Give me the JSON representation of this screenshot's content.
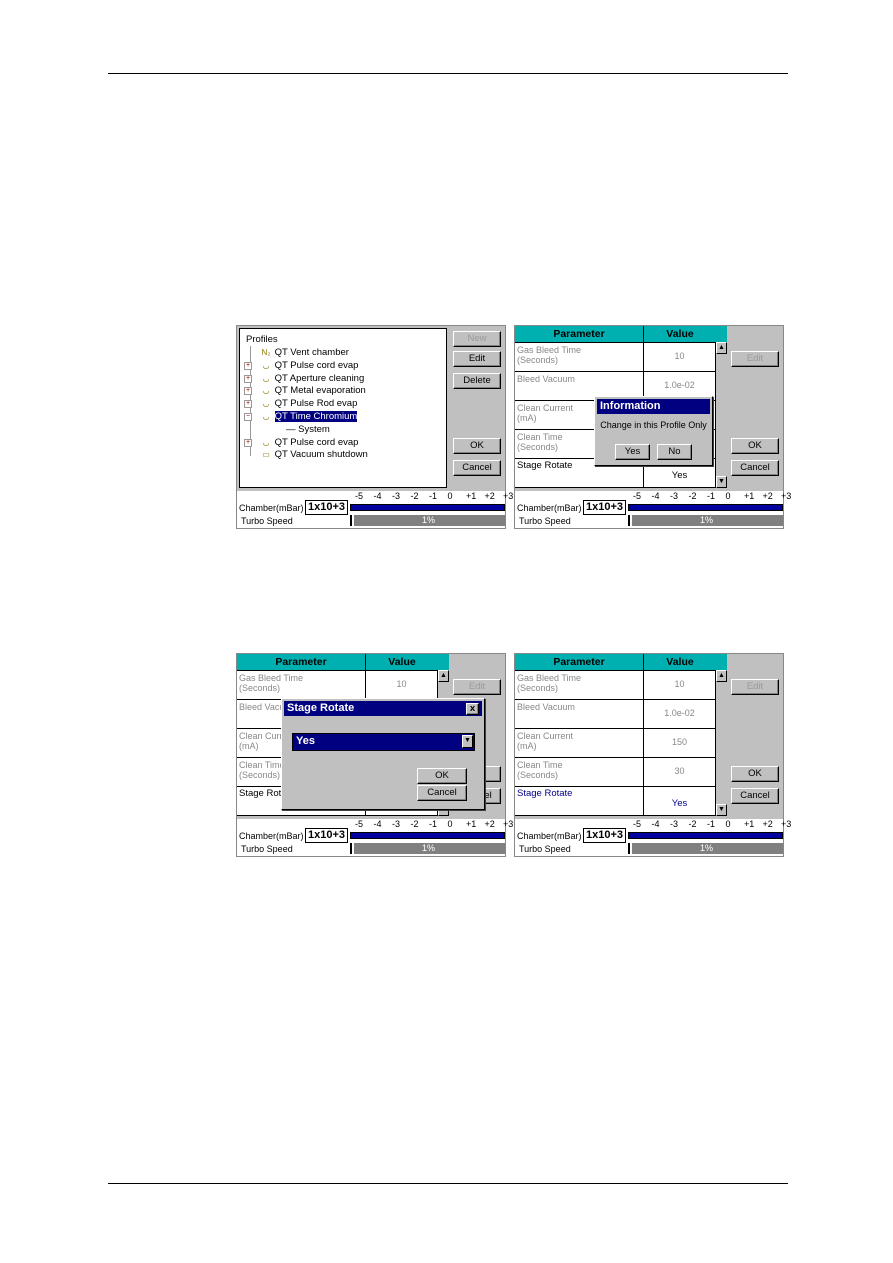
{
  "common": {
    "chamber_label": "Chamber(mBar)",
    "chamber_value": "1x10+3",
    "scale_ticks": [
      "-5",
      "-4",
      "-3",
      "-2",
      "-1",
      "0",
      "+1",
      "+2",
      "+3"
    ],
    "turbo_label": "Turbo Speed",
    "turbo_value": "1%",
    "turbo_fraction": 0.01,
    "param_header": "Parameter",
    "value_header": "Value",
    "edit": "Edit",
    "ok": "OK",
    "cancel": "Cancel"
  },
  "profiles_panel": {
    "root": "Profiles",
    "buttons": {
      "new": "New",
      "edit": "Edit",
      "delete": "Delete",
      "ok": "OK",
      "cancel": "Cancel"
    },
    "items": [
      {
        "label": "QT Vent chamber",
        "icon": "n2-icon",
        "expand": false,
        "indent": 0
      },
      {
        "label": "QT Pulse cord evap",
        "icon": "profile-icon",
        "expand": true,
        "indent": 0
      },
      {
        "label": "QT Aperture cleaning",
        "icon": "profile-icon",
        "expand": true,
        "indent": 0
      },
      {
        "label": "QT Metal evaporation",
        "icon": "profile-icon",
        "expand": true,
        "indent": 0
      },
      {
        "label": "QT Pulse Rod evap",
        "icon": "profile-icon",
        "expand": true,
        "indent": 0
      },
      {
        "label": "QT Time Chromium",
        "icon": "profile-icon",
        "expand": true,
        "indent": 0,
        "selected": true
      },
      {
        "label": "System",
        "icon": "",
        "expand": false,
        "indent": 1
      },
      {
        "label": "QT Pulse cord evap",
        "icon": "profile-icon",
        "expand": true,
        "indent": 0
      },
      {
        "label": "QT Vacuum shutdown",
        "icon": "vacuum-icon",
        "expand": false,
        "indent": 0
      }
    ]
  },
  "parameters": [
    {
      "name": "Gas Bleed Time\n(Seconds)",
      "value": "10"
    },
    {
      "name": "Bleed Vacuum",
      "value": "1.0e-02"
    },
    {
      "name": "Clean Current\n(mA)",
      "value": "150"
    },
    {
      "name": "Clean Time\n(Seconds)",
      "value": "30"
    },
    {
      "name": "Stage Rotate",
      "value": "Yes"
    }
  ],
  "info_dialog": {
    "title": "Information",
    "message": "Change in this Profile Only",
    "yes": "Yes",
    "no": "No"
  },
  "stage_dialog": {
    "title": "Stage Rotate",
    "selected": "Yes",
    "ok": "OK",
    "cancel": "Cancel",
    "close": "x"
  }
}
